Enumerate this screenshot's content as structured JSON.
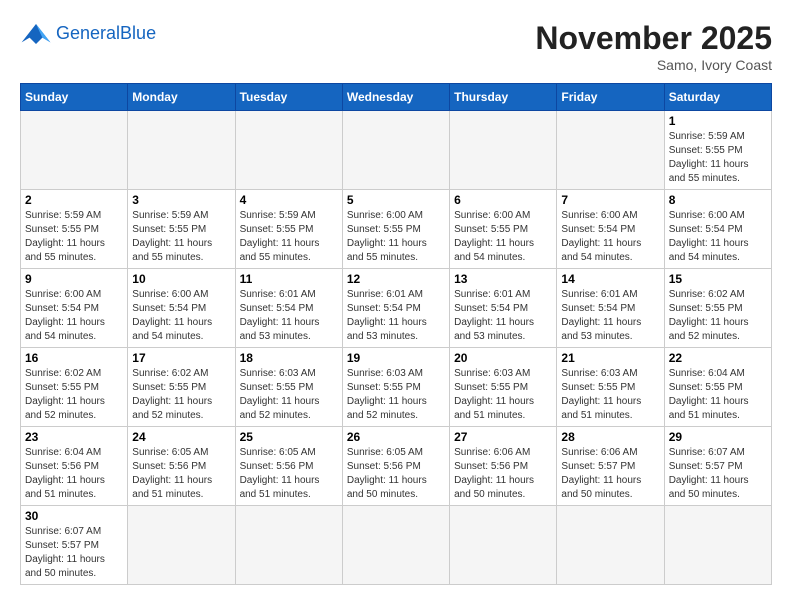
{
  "header": {
    "logo_general": "General",
    "logo_blue": "Blue",
    "month_title": "November 2025",
    "location": "Samo, Ivory Coast"
  },
  "weekdays": [
    "Sunday",
    "Monday",
    "Tuesday",
    "Wednesday",
    "Thursday",
    "Friday",
    "Saturday"
  ],
  "days": [
    {
      "num": "",
      "info": ""
    },
    {
      "num": "",
      "info": ""
    },
    {
      "num": "",
      "info": ""
    },
    {
      "num": "",
      "info": ""
    },
    {
      "num": "",
      "info": ""
    },
    {
      "num": "",
      "info": ""
    },
    {
      "num": "1",
      "sunrise": "5:59 AM",
      "sunset": "5:55 PM",
      "daylight": "11 hours and 55 minutes."
    },
    {
      "num": "2",
      "sunrise": "5:59 AM",
      "sunset": "5:55 PM",
      "daylight": "11 hours and 55 minutes."
    },
    {
      "num": "3",
      "sunrise": "5:59 AM",
      "sunset": "5:55 PM",
      "daylight": "11 hours and 55 minutes."
    },
    {
      "num": "4",
      "sunrise": "5:59 AM",
      "sunset": "5:55 PM",
      "daylight": "11 hours and 55 minutes."
    },
    {
      "num": "5",
      "sunrise": "6:00 AM",
      "sunset": "5:55 PM",
      "daylight": "11 hours and 55 minutes."
    },
    {
      "num": "6",
      "sunrise": "6:00 AM",
      "sunset": "5:55 PM",
      "daylight": "11 hours and 54 minutes."
    },
    {
      "num": "7",
      "sunrise": "6:00 AM",
      "sunset": "5:54 PM",
      "daylight": "11 hours and 54 minutes."
    },
    {
      "num": "8",
      "sunrise": "6:00 AM",
      "sunset": "5:54 PM",
      "daylight": "11 hours and 54 minutes."
    },
    {
      "num": "9",
      "sunrise": "6:00 AM",
      "sunset": "5:54 PM",
      "daylight": "11 hours and 54 minutes."
    },
    {
      "num": "10",
      "sunrise": "6:00 AM",
      "sunset": "5:54 PM",
      "daylight": "11 hours and 54 minutes."
    },
    {
      "num": "11",
      "sunrise": "6:01 AM",
      "sunset": "5:54 PM",
      "daylight": "11 hours and 53 minutes."
    },
    {
      "num": "12",
      "sunrise": "6:01 AM",
      "sunset": "5:54 PM",
      "daylight": "11 hours and 53 minutes."
    },
    {
      "num": "13",
      "sunrise": "6:01 AM",
      "sunset": "5:54 PM",
      "daylight": "11 hours and 53 minutes."
    },
    {
      "num": "14",
      "sunrise": "6:01 AM",
      "sunset": "5:54 PM",
      "daylight": "11 hours and 53 minutes."
    },
    {
      "num": "15",
      "sunrise": "6:02 AM",
      "sunset": "5:55 PM",
      "daylight": "11 hours and 52 minutes."
    },
    {
      "num": "16",
      "sunrise": "6:02 AM",
      "sunset": "5:55 PM",
      "daylight": "11 hours and 52 minutes."
    },
    {
      "num": "17",
      "sunrise": "6:02 AM",
      "sunset": "5:55 PM",
      "daylight": "11 hours and 52 minutes."
    },
    {
      "num": "18",
      "sunrise": "6:03 AM",
      "sunset": "5:55 PM",
      "daylight": "11 hours and 52 minutes."
    },
    {
      "num": "19",
      "sunrise": "6:03 AM",
      "sunset": "5:55 PM",
      "daylight": "11 hours and 52 minutes."
    },
    {
      "num": "20",
      "sunrise": "6:03 AM",
      "sunset": "5:55 PM",
      "daylight": "11 hours and 51 minutes."
    },
    {
      "num": "21",
      "sunrise": "6:03 AM",
      "sunset": "5:55 PM",
      "daylight": "11 hours and 51 minutes."
    },
    {
      "num": "22",
      "sunrise": "6:04 AM",
      "sunset": "5:55 PM",
      "daylight": "11 hours and 51 minutes."
    },
    {
      "num": "23",
      "sunrise": "6:04 AM",
      "sunset": "5:56 PM",
      "daylight": "11 hours and 51 minutes."
    },
    {
      "num": "24",
      "sunrise": "6:05 AM",
      "sunset": "5:56 PM",
      "daylight": "11 hours and 51 minutes."
    },
    {
      "num": "25",
      "sunrise": "6:05 AM",
      "sunset": "5:56 PM",
      "daylight": "11 hours and 51 minutes."
    },
    {
      "num": "26",
      "sunrise": "6:05 AM",
      "sunset": "5:56 PM",
      "daylight": "11 hours and 50 minutes."
    },
    {
      "num": "27",
      "sunrise": "6:06 AM",
      "sunset": "5:56 PM",
      "daylight": "11 hours and 50 minutes."
    },
    {
      "num": "28",
      "sunrise": "6:06 AM",
      "sunset": "5:57 PM",
      "daylight": "11 hours and 50 minutes."
    },
    {
      "num": "29",
      "sunrise": "6:07 AM",
      "sunset": "5:57 PM",
      "daylight": "11 hours and 50 minutes."
    },
    {
      "num": "30",
      "sunrise": "6:07 AM",
      "sunset": "5:57 PM",
      "daylight": "11 hours and 50 minutes."
    }
  ]
}
